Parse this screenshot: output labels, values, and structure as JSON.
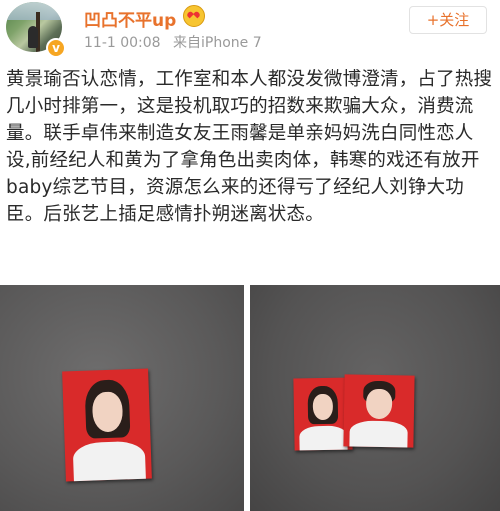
{
  "post": {
    "username": "凹凸不平up",
    "timestamp": "11-1 00:08",
    "source": "来自iPhone 7",
    "follow_label": "+关注",
    "text": "黄景瑜否认恋情，工作室和本人都没发微博澄清，占了热搜几小时排第一，这是投机取巧的招数来欺骗大众，消费流量。联手卓伟来制造女友王雨馨是单亲妈妈洗白同性恋人设,前经纪人和黄为了拿角色出卖肉体，韩寒的戏还有放开baby综艺节目，资源怎么来的还得亏了经纪人刘铮大功臣。后张艺上插足感情扑朔迷离状态。"
  },
  "images": [
    {
      "subject": "woman-id-photo"
    },
    {
      "subject": "couple-id-photos"
    }
  ],
  "icons": {
    "verified": "verified-badge-icon",
    "emoji": "heart-eyes-emoji-icon"
  },
  "colors": {
    "username": "#e8722c",
    "follow": "#e8722c",
    "meta": "#9a9a9a",
    "badge": "#f6a623",
    "id_photo_bg": "#d92a2a"
  }
}
